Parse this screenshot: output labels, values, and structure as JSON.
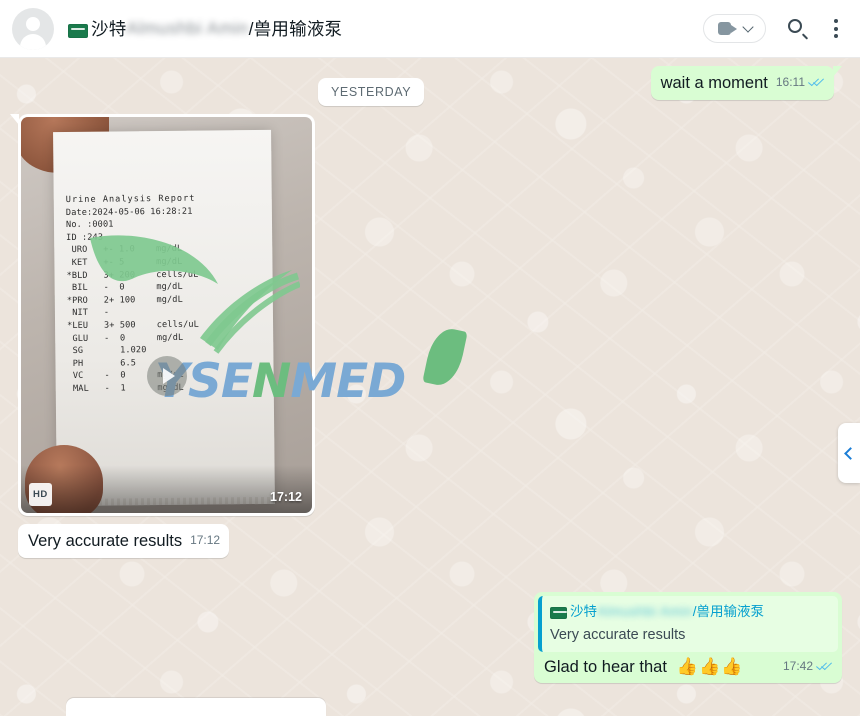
{
  "header": {
    "avatar_alt": "default-contact-avatar",
    "flag": "saudi-arabia-flag",
    "name_prefix": "沙特",
    "name_blurred": "Almushbi Amin",
    "name_suffix": "/兽用输液泵",
    "video_call_label": "video-call",
    "search_label": "search",
    "menu_label": "menu"
  },
  "chat": {
    "day_divider": "YESTERDAY",
    "messages": [
      {
        "id": "m1",
        "direction": "out",
        "type": "text",
        "text": "wait a moment",
        "time": "16:11",
        "status": "read"
      },
      {
        "id": "m2",
        "direction": "in",
        "type": "image",
        "time": "17:12",
        "quality_badge": "HD",
        "report": {
          "title": "Urine Analysis Report",
          "date_label": "Date:2024-05-06 16:28:21",
          "no_label": "No. :0001",
          "id_label": "ID :243",
          "rows": [
            {
              "mark": " ",
              "name": "URO",
              "flag": "+-",
              "value": "1.0",
              "unit": "mg/dL"
            },
            {
              "mark": " ",
              "name": "KET",
              "flag": "+-",
              "value": "5",
              "unit": "mg/dL"
            },
            {
              "mark": "*",
              "name": "BLD",
              "flag": "3+",
              "value": "200",
              "unit": "cells/uL"
            },
            {
              "mark": " ",
              "name": "BIL",
              "flag": "-",
              "value": "0",
              "unit": "mg/dL"
            },
            {
              "mark": "*",
              "name": "PRO",
              "flag": "2+",
              "value": "100",
              "unit": "mg/dL"
            },
            {
              "mark": " ",
              "name": "NIT",
              "flag": "-",
              "value": "",
              "unit": ""
            },
            {
              "mark": "*",
              "name": "LEU",
              "flag": "3+",
              "value": "500",
              "unit": "cells/uL"
            },
            {
              "mark": " ",
              "name": "GLU",
              "flag": "-",
              "value": "0",
              "unit": "mg/dL"
            },
            {
              "mark": " ",
              "name": "SG",
              "flag": "",
              "value": "1.020",
              "unit": ""
            },
            {
              "mark": " ",
              "name": "PH",
              "flag": "",
              "value": "6.5",
              "unit": ""
            },
            {
              "mark": " ",
              "name": "VC",
              "flag": "-",
              "value": "0",
              "unit": "mg/dL"
            },
            {
              "mark": " ",
              "name": "MAL",
              "flag": "-",
              "value": "1",
              "unit": "mg/dL"
            }
          ]
        }
      },
      {
        "id": "m3",
        "direction": "in",
        "type": "text",
        "text": "Very accurate results",
        "time": "17:12",
        "status": "none"
      },
      {
        "id": "m4",
        "direction": "out",
        "type": "reply",
        "quote_name_prefix": "沙特",
        "quote_name_blurred": "Almushbi Amin",
        "quote_name_suffix": "/兽用输液泵",
        "quote_text": "Very accurate results",
        "text": "Glad to hear that",
        "emojis": "👍👍👍",
        "time": "17:42",
        "status": "read"
      }
    ]
  },
  "watermark": {
    "part1": "YSE",
    "part2": "N",
    "part3": "MED"
  },
  "edge_tab": {
    "icon": "chevron-left-icon"
  },
  "colors": {
    "outgoing_bubble": "#d9fdd3",
    "incoming_bubble": "#ffffff",
    "chat_background": "#ece4dc",
    "tick_read": "#53bdeb",
    "quote_accent": "#06a0cf",
    "watermark_blue": "#7aa9d4",
    "watermark_green": "#6cbd7f"
  }
}
